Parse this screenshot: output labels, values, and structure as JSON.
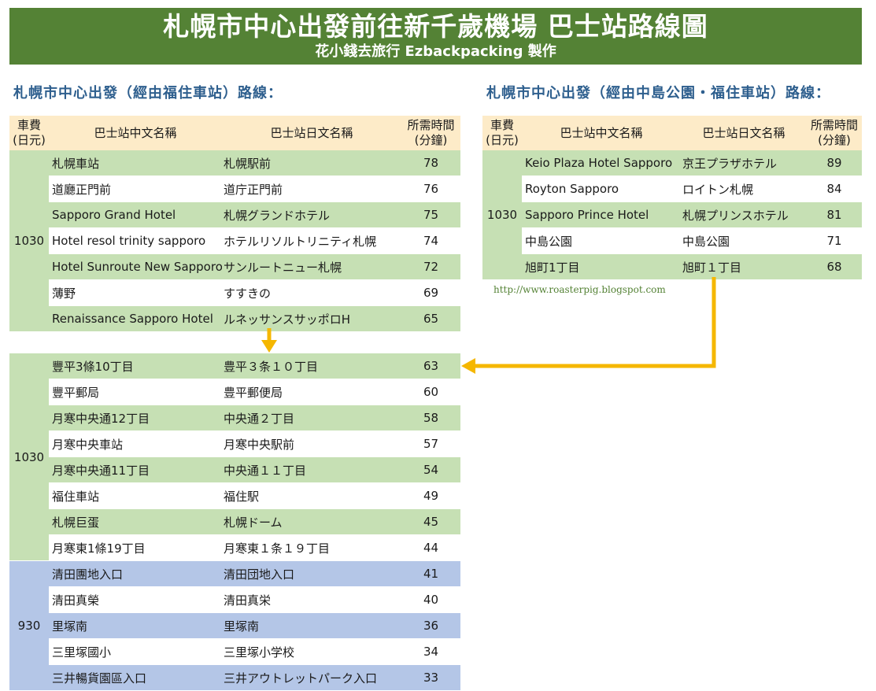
{
  "header": {
    "title": "札幌市中心出發前往新千歲機場 巴士站路線圖",
    "subtitle": "花小錢去旅行 Ezbackpacking 製作"
  },
  "columns": {
    "fare_line1": "車費",
    "fare_line2": "(日元)",
    "zh": "巴士站中文名稱",
    "ja": "巴士站日文名稱",
    "time_line1": "所需時間",
    "time_line2": "(分鐘)"
  },
  "left_route": {
    "heading": "札幌市中心出發（經由福住車站）路線：",
    "fare": "1030",
    "rows": [
      {
        "zh": "札幌車站",
        "ja": "札幌駅前",
        "min": "78"
      },
      {
        "zh": "道廳正門前",
        "ja": "道庁正門前",
        "min": "76"
      },
      {
        "zh": "Sapporo Grand Hotel",
        "ja": "札幌グランドホテル",
        "min": "75"
      },
      {
        "zh": "Hotel resol trinity sapporo",
        "ja": "ホテルリソルトリニティ札幌",
        "min": "74"
      },
      {
        "zh": "Hotel Sunroute New Sapporo",
        "ja": "サンルートニュー札幌",
        "min": "72"
      },
      {
        "zh": "薄野",
        "ja": "すすきの",
        "min": "69"
      },
      {
        "zh": "Renaissance Sapporo Hotel",
        "ja": "ルネッサンスサッポロH",
        "min": "65"
      }
    ]
  },
  "right_route": {
    "heading": "札幌市中心出發（經由中島公園・福住車站）路線：",
    "fare": "1030",
    "rows": [
      {
        "zh": "Keio Plaza Hotel Sapporo",
        "ja": "京王プラザホテル",
        "min": "89"
      },
      {
        "zh": "Royton Sapporo",
        "ja": "ロイトン札幌",
        "min": "84"
      },
      {
        "zh": "Sapporo Prince Hotel",
        "ja": "札幌プリンスホテル",
        "min": "81"
      },
      {
        "zh": "中島公園",
        "ja": "中島公園",
        "min": "71"
      },
      {
        "zh": "旭町1丁目",
        "ja": "旭町１丁目",
        "min": "68"
      }
    ],
    "url": "http://www.roasterpig.blogspot.com"
  },
  "shared_route": {
    "group_1030": {
      "fare": "1030",
      "rows": [
        {
          "zh": "豐平3條10丁目",
          "ja": "豊平３条１０丁目",
          "min": "63"
        },
        {
          "zh": "豐平郵局",
          "ja": "豊平郵便局",
          "min": "60"
        },
        {
          "zh": "月寒中央通12丁目",
          "ja": "中央通２丁目",
          "min": "58"
        },
        {
          "zh": "月寒中央車站",
          "ja": "月寒中央駅前",
          "min": "57"
        },
        {
          "zh": "月寒中央通11丁目",
          "ja": "中央通１１丁目",
          "min": "54"
        },
        {
          "zh": "福住車站",
          "ja": "福住駅",
          "min": "49"
        },
        {
          "zh": "札幌巨蛋",
          "ja": "札幌ドーム",
          "min": "45"
        },
        {
          "zh": "月寒東1條19丁目",
          "ja": "月寒東１条１９丁目",
          "min": "44"
        }
      ]
    },
    "group_930": {
      "fare": "930",
      "rows": [
        {
          "zh": "清田團地入口",
          "ja": "清田団地入口",
          "min": "41"
        },
        {
          "zh": "清田真榮",
          "ja": "清田真栄",
          "min": "40"
        },
        {
          "zh": "里塚南",
          "ja": "里塚南",
          "min": "36"
        },
        {
          "zh": "三里塚國小",
          "ja": "三里塚小学校",
          "min": "34"
        },
        {
          "zh": "三井暢貨園區入口",
          "ja": "三井アウトレットパーク入口",
          "min": "33"
        }
      ]
    }
  },
  "colors": {
    "header_bg": "#548235",
    "heading_text": "#2e5f8e",
    "column_header_bg": "#fdebc8",
    "row_green": "#c6e0b4",
    "row_blue": "#b4c6e7",
    "arrow": "#f5b700"
  }
}
